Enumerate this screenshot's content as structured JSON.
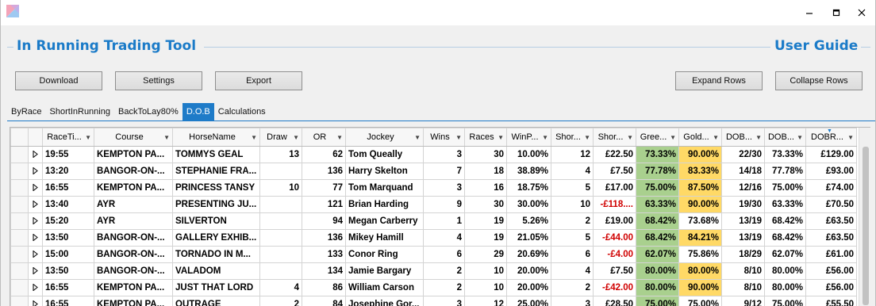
{
  "app": {
    "title": "In Running Trading Tool",
    "user_guide": "User Guide"
  },
  "window_controls": {
    "minimize": "–",
    "maximize": "☐",
    "close": "✕"
  },
  "toolbar": {
    "download": "Download",
    "settings": "Settings",
    "export": "Export",
    "expand_rows": "Expand Rows",
    "collapse_rows": "Collapse Rows"
  },
  "tabs": [
    "ByRace",
    "ShortInRunning",
    "BackToLay80%",
    "D.O.B",
    "Calculations"
  ],
  "active_tab": "D.O.B",
  "grid": {
    "columns": [
      "RaceTi...",
      "Course",
      "HorseName",
      "Draw",
      "OR",
      "Jockey",
      "Wins",
      "Races",
      "WinP...",
      "Shor...",
      "Shor...",
      "Gree...",
      "Gold...",
      "DOB...",
      "DOB...",
      "DOBR..."
    ],
    "rows": [
      [
        "19:55",
        "KEMPTON  PA...",
        "TOMMYS GEAL",
        "13",
        "62",
        "Tom Queally",
        "3",
        "30",
        "10.00%",
        "12",
        "£22.50",
        "73.33%",
        "90.00%",
        "22/30",
        "73.33%",
        "£129.00"
      ],
      [
        "13:20",
        "BANGOR-ON-...",
        "STEPHANIE  FRA...",
        "",
        "136",
        "Harry Skelton",
        "7",
        "18",
        "38.89%",
        "4",
        "£7.50",
        "77.78%",
        "83.33%",
        "14/18",
        "77.78%",
        "£93.00"
      ],
      [
        "16:55",
        "KEMPTON  PA...",
        "PRINCESS TANSY",
        "10",
        "77",
        "Tom Marquand",
        "3",
        "16",
        "18.75%",
        "5",
        "£17.00",
        "75.00%",
        "87.50%",
        "12/16",
        "75.00%",
        "£74.00"
      ],
      [
        "13:40",
        "AYR",
        "PRESENTING  JU...",
        "",
        "121",
        "Brian Harding",
        "9",
        "30",
        "30.00%",
        "10",
        "-£118....",
        "63.33%",
        "90.00%",
        "19/30",
        "63.33%",
        "£70.50"
      ],
      [
        "15:20",
        "AYR",
        "SILVERTON",
        "",
        "94",
        "Megan Carberry",
        "1",
        "19",
        "5.26%",
        "2",
        "£19.00",
        "68.42%",
        "73.68%",
        "13/19",
        "68.42%",
        "£63.50"
      ],
      [
        "13:50",
        "BANGOR-ON-...",
        "GALLERY  EXHIB...",
        "",
        "136",
        "Mikey Hamill",
        "4",
        "19",
        "21.05%",
        "5",
        "-£44.00",
        "68.42%",
        "84.21%",
        "13/19",
        "68.42%",
        "£63.50"
      ],
      [
        "15:00",
        "BANGOR-ON-...",
        "TORNADO IN M...",
        "",
        "133",
        "Conor Ring",
        "6",
        "29",
        "20.69%",
        "6",
        "-£4.00",
        "62.07%",
        "75.86%",
        "18/29",
        "62.07%",
        "£61.00"
      ],
      [
        "13:50",
        "BANGOR-ON-...",
        "VALADOM",
        "",
        "134",
        "Jamie Bargary",
        "2",
        "10",
        "20.00%",
        "4",
        "£7.50",
        "80.00%",
        "80.00%",
        "8/10",
        "80.00%",
        "£56.00"
      ],
      [
        "16:55",
        "KEMPTON  PA...",
        "JUST THAT LORD",
        "4",
        "86",
        "William Carson",
        "2",
        "10",
        "20.00%",
        "2",
        "-£42.00",
        "80.00%",
        "90.00%",
        "8/10",
        "80.00%",
        "£56.00"
      ],
      [
        "16:55",
        "KEMPTON  PA...",
        "OUTRAGE",
        "2",
        "84",
        "Josephine  Gor...",
        "3",
        "12",
        "25.00%",
        "3",
        "£28.50",
        "75.00%",
        "75.00%",
        "9/12",
        "75.00%",
        "£55.50"
      ]
    ],
    "gold_highlight": [
      true,
      true,
      true,
      true,
      false,
      true,
      false,
      true,
      true,
      false
    ],
    "colors": {
      "green": "#a9d08e",
      "gold": "#ffd966",
      "negative": "#d00000",
      "accent": "#1b7bc8"
    }
  }
}
